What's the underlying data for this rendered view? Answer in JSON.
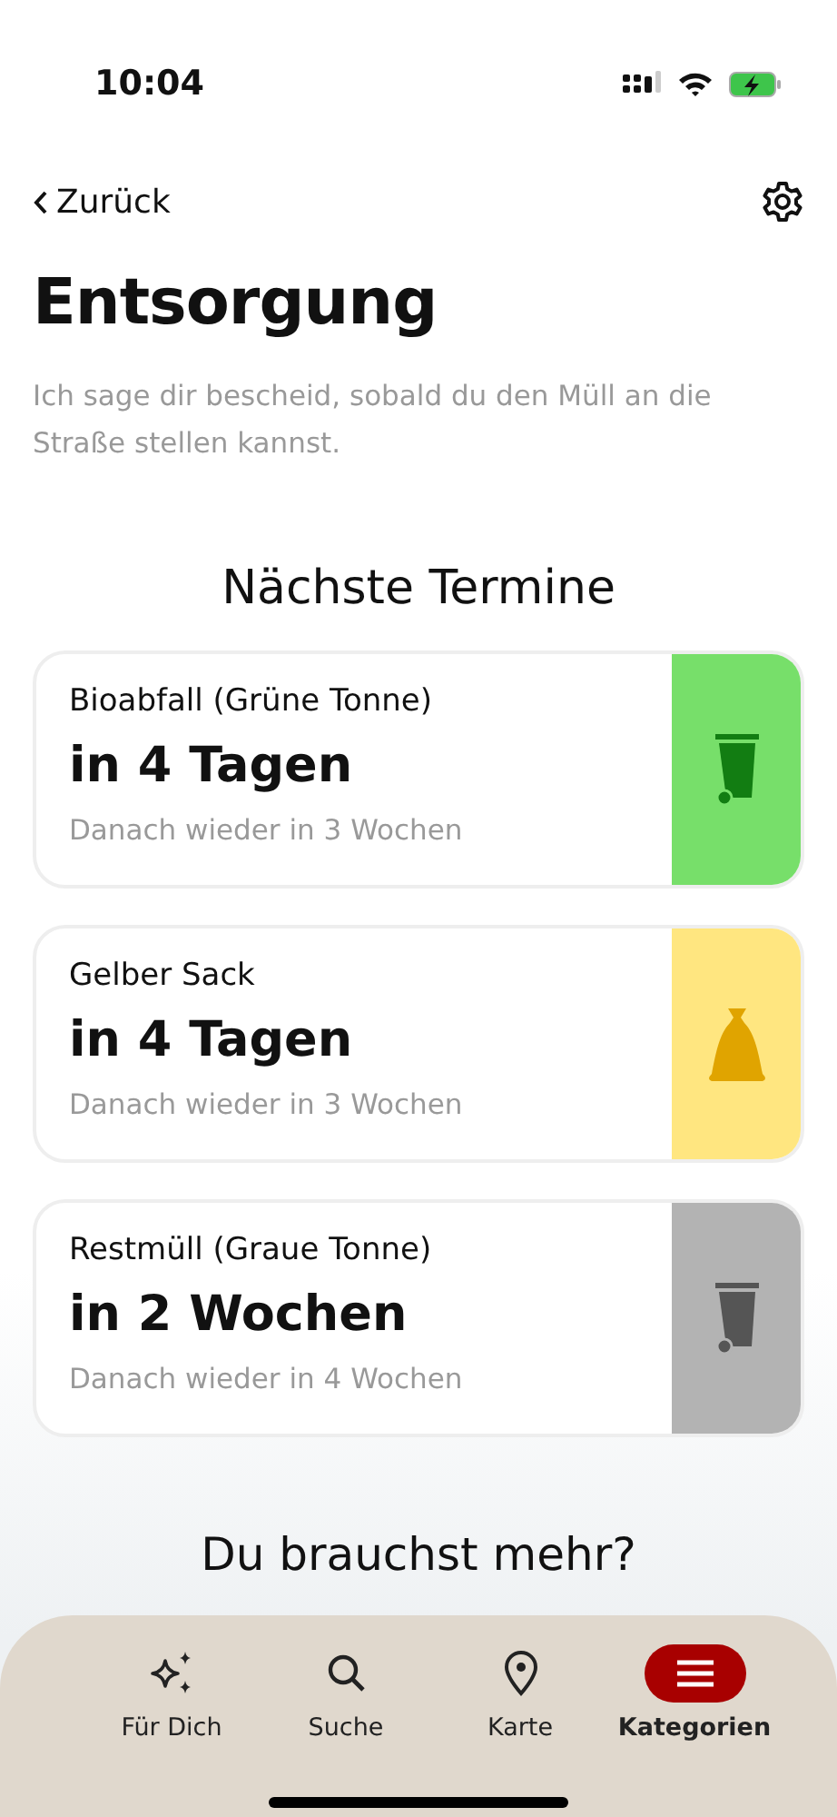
{
  "status_bar": {
    "time": "10:04"
  },
  "nav": {
    "back": "Zurück"
  },
  "title": "Entsorgung",
  "subtitle": "Ich sage dir bescheid, sobald du den Müll an die Straße stellen kannst.",
  "section_title": "Nächste Termine",
  "dates": [
    {
      "type": "Bioabfall (Grüne Tonne)",
      "due": "in 4 Tagen",
      "next": "Danach wieder in 3 Wochen",
      "color": "#77df6a",
      "kind": "bin"
    },
    {
      "type": "Gelber Sack",
      "due": "in 4 Tagen",
      "next": "Danach wieder in 3 Wochen",
      "color": "#ffe680",
      "kind": "bag"
    },
    {
      "type": "Restmüll (Graue Tonne)",
      "due": "in 2 Wochen",
      "next": "Danach wieder in 4 Wochen",
      "color": "#b3b3b3",
      "kind": "bin"
    }
  ],
  "more_title": "Du brauchst mehr?",
  "tabs": [
    {
      "label": "Für Dich",
      "kind": "sparkles",
      "selected": false
    },
    {
      "label": "Suche",
      "kind": "search",
      "selected": false
    },
    {
      "label": "Karte",
      "kind": "pin",
      "selected": false
    },
    {
      "label": "Kategorien",
      "kind": "menu",
      "selected": true
    }
  ]
}
